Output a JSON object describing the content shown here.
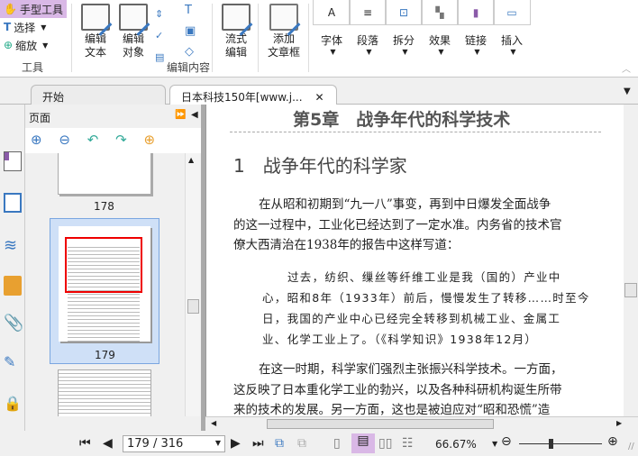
{
  "ribbon": {
    "tools": {
      "hand": "手型工具",
      "select": "选择",
      "zoom": "缩放",
      "group": "工具"
    },
    "edit": {
      "edit_text": [
        "编辑",
        "文本"
      ],
      "edit_object": [
        "编辑",
        "对象"
      ],
      "flow_edit": [
        "流式",
        "编辑"
      ],
      "add_frame": [
        "添加",
        "文章框"
      ],
      "group": "编辑内容"
    },
    "small_buttons": [
      "字体",
      "段落",
      "拆分",
      "效果",
      "链接",
      "插入"
    ]
  },
  "tabs": [
    {
      "label": "开始"
    },
    {
      "label": "日本科技150年[www.j..."
    }
  ],
  "panel": {
    "title": "页面",
    "thumbnails": [
      {
        "page": "178"
      },
      {
        "page": "179",
        "selected": true
      }
    ]
  },
  "document": {
    "chapter_title": "第5章　战争年代的科学技术",
    "section_title": "1　战争年代的科学家",
    "para1": [
      "在从昭和初期到“九一八”事变，再到中日爆发全面战争",
      "的这一过程中，工业化已经达到了一定水准。内务省的技术官",
      "僚大西清治在1938年的报告中这样写道："
    ],
    "quote": [
      "过去，纺织、缫丝等纤维工业是我（国的）产业中",
      "心，昭和8年（1933年）前后，慢慢发生了转移……时至今",
      "日，我国的产业中心已经完全转移到机械工业、金属工",
      "业、化学工业上了。（《科学知识》1938年12月）"
    ],
    "para2": [
      "在这一时期，科学家们强烈主张振兴科学技术。一方面，",
      "这反映了日本重化学工业的勃兴，以及各种科研机构诞生所带",
      "来的技术的发展。另一方面，这也是被迫应对“昭和恐慌”造"
    ]
  },
  "status": {
    "page_input": "179 / 316",
    "zoom": "66.67%",
    "zoom_slider_percent": 40
  },
  "colors": {
    "accent": "#d9b8e6",
    "blue": "#3a78c0"
  }
}
